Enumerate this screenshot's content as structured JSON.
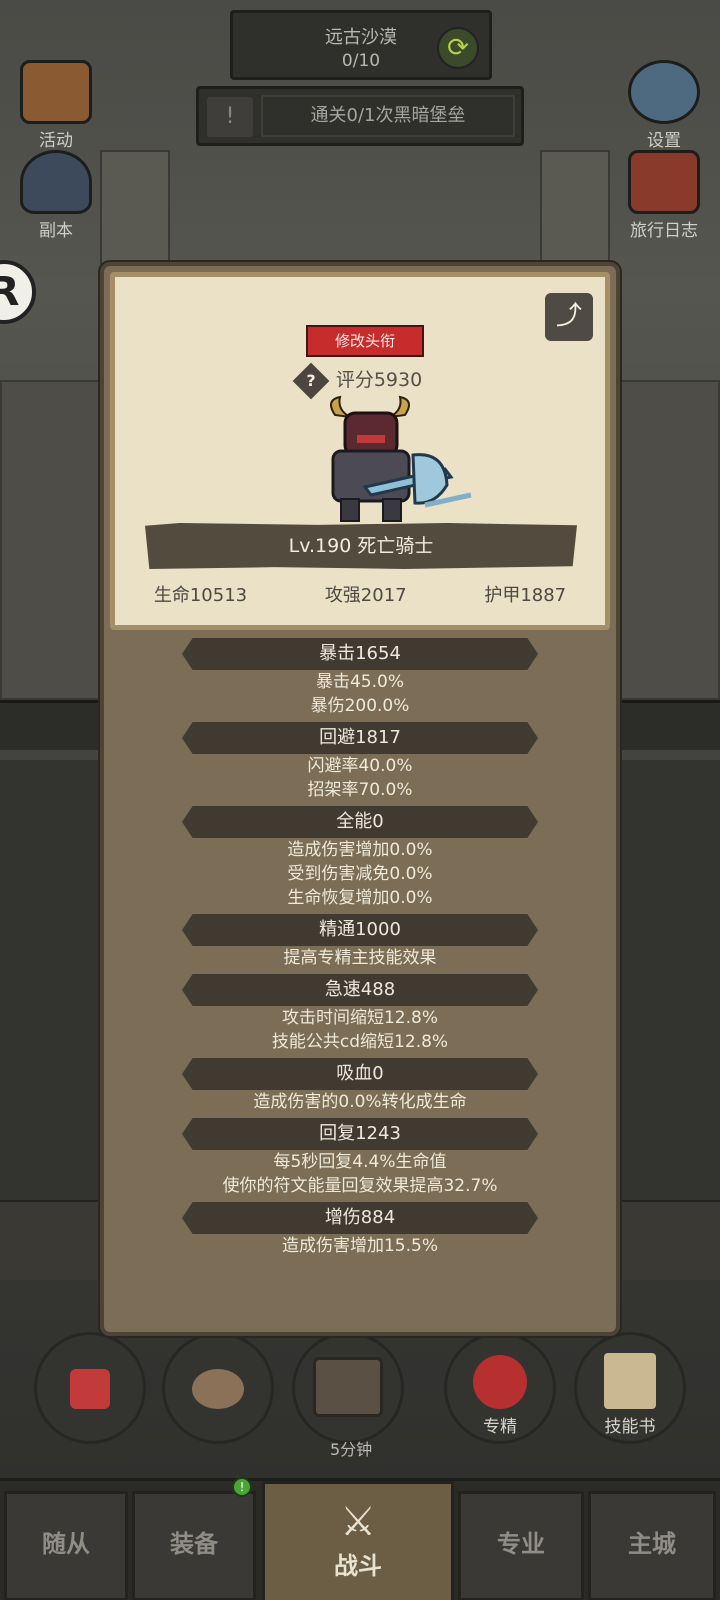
{
  "top": {
    "area_name": "远古沙漠",
    "area_progress": "0/10",
    "quest": "通关0/1次黑暗堡垒"
  },
  "side_buttons": {
    "activity": "活动",
    "dungeon": "副本",
    "settings": "设置",
    "journal": "旅行日志"
  },
  "panel": {
    "edit_title": "修改头衔",
    "score": "评分5930",
    "level_class": "Lv.190 死亡骑士",
    "base_stats": [
      "生命10513",
      "攻强2017",
      "护甲1887"
    ]
  },
  "stat_groups": [
    {
      "head": "暴击1654",
      "lines": [
        "暴击45.0%",
        "暴伤200.0%"
      ]
    },
    {
      "head": "回避1817",
      "lines": [
        "闪避率40.0%",
        "招架率70.0%"
      ]
    },
    {
      "head": "全能0",
      "lines": [
        "造成伤害增加0.0%",
        "受到伤害减免0.0%",
        "生命恢复增加0.0%"
      ]
    },
    {
      "head": "精通1000",
      "lines": [
        "提高专精主技能效果"
      ]
    },
    {
      "head": "急速488",
      "lines": [
        "攻击时间缩短12.8%",
        "技能公共cd缩短12.8%"
      ]
    },
    {
      "head": "吸血0",
      "lines": [
        "造成伤害的0.0%转化成生命"
      ]
    },
    {
      "head": "回复1243",
      "lines": [
        "每5秒回复4.4%生命值",
        "使你的符文能量回复效果提高32.7%"
      ]
    },
    {
      "head": "增伤884",
      "lines": [
        "造成伤害增加15.5%"
      ]
    }
  ],
  "bottom_skills": {
    "chest_timer": "5分钟",
    "specialty": "专精",
    "skill_book": "技能书"
  },
  "nav": [
    "随从",
    "装备",
    "战斗",
    "专业",
    "主城"
  ],
  "colors": {
    "panel_bg": "#7b6d56",
    "card_bg": "#ebe1c7",
    "title_btn": "#c72c2c",
    "stat_head": "#403a31"
  }
}
